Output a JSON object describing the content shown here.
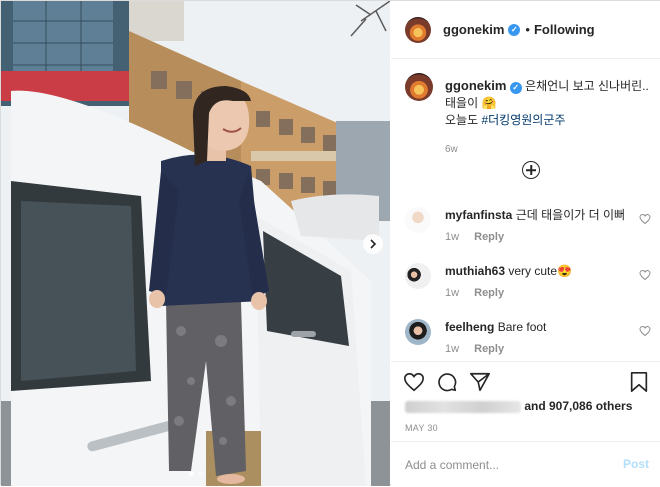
{
  "header": {
    "username": "ggonekim",
    "separator": "•",
    "follow_label": "Following"
  },
  "caption": {
    "username": "ggonekim",
    "text": "은채언니 보고 신나버린.. 태을이 🤗",
    "line2_prefix": "오늘도 ",
    "hashtag": "#더킹영원의군주",
    "time": "6w"
  },
  "comments": [
    {
      "username": "myfanfinsta",
      "text": "근데 태을이가 더 이뻐",
      "time": "1w",
      "reply_label": "Reply"
    },
    {
      "username": "muthiah63",
      "text": "very cute😍",
      "time": "1w",
      "reply_label": "Reply"
    },
    {
      "username": "feelheng",
      "text": "Bare foot",
      "time": "1w",
      "reply_label": "Reply"
    }
  ],
  "likes": {
    "text": "and 907,086 others"
  },
  "date": "MAY 30",
  "add_comment": {
    "placeholder": "Add a comment...",
    "post_label": "Post"
  },
  "icons": [
    "verified-icon",
    "add-circle-icon",
    "heart-icon",
    "comment-icon",
    "share-icon",
    "bookmark-icon",
    "chevron-right-icon"
  ],
  "colors": {
    "accent": "#3897f0",
    "post_disabled": "#b2dffc",
    "hashtag": "#00376b"
  }
}
